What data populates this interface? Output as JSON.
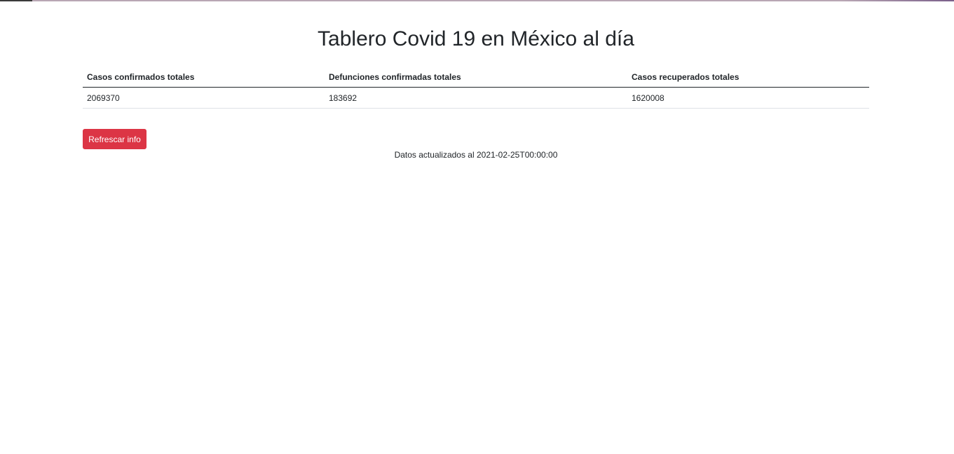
{
  "header": {
    "title": "Tablero Covid 19 en México al día"
  },
  "table": {
    "columns": [
      "Casos confirmados totales",
      "Defunciones confirmadas totales",
      "Casos recuperados totales"
    ],
    "rows": [
      [
        "2069370",
        "183692",
        "1620008"
      ]
    ]
  },
  "actions": {
    "refresh_label": "Refrescar info"
  },
  "footer": {
    "updated_text": "Datos actualizados al 2021-02-25T00:00:00"
  },
  "colors": {
    "refresh_button": "#dc3545",
    "text": "#212529"
  }
}
